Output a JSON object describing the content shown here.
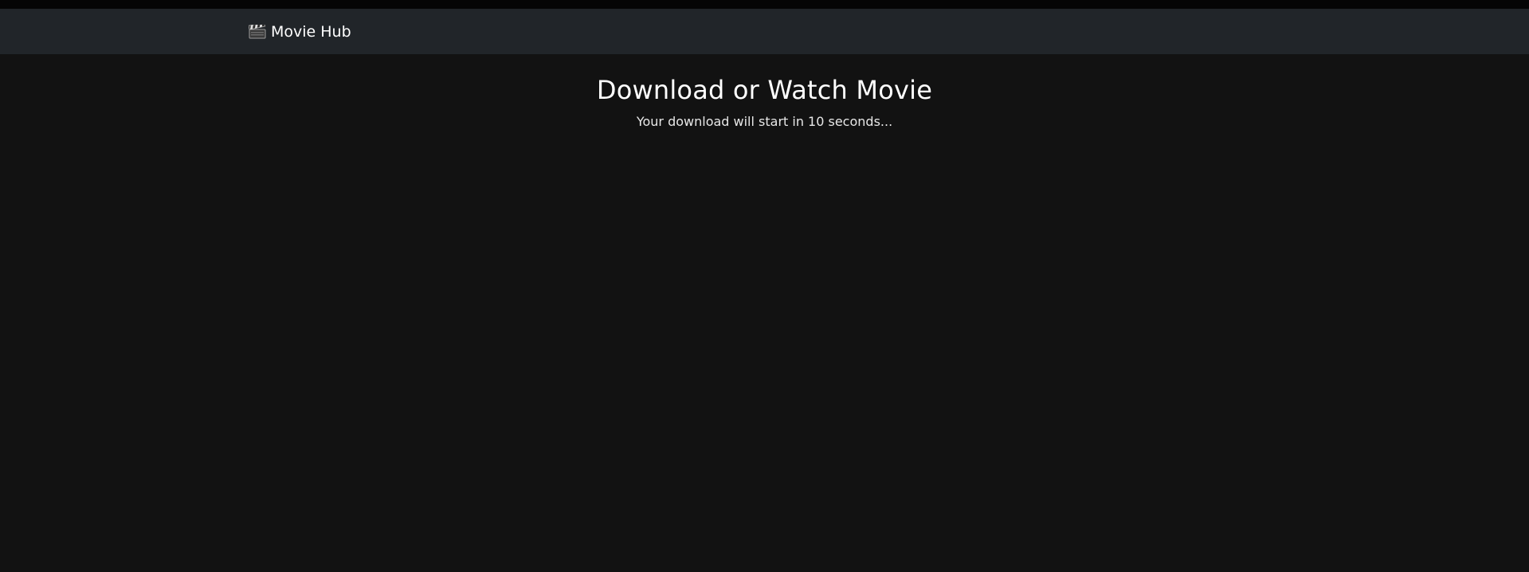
{
  "navbar": {
    "brand_label": "Movie Hub",
    "brand_icon": "clapperboard-icon"
  },
  "main": {
    "title": "Download or Watch Movie",
    "message": "Your download will start in 10 seconds..."
  },
  "colors": {
    "page_background": "#121212",
    "navbar_background": "#212529",
    "top_strip": "#050505",
    "text": "#ffffff"
  }
}
